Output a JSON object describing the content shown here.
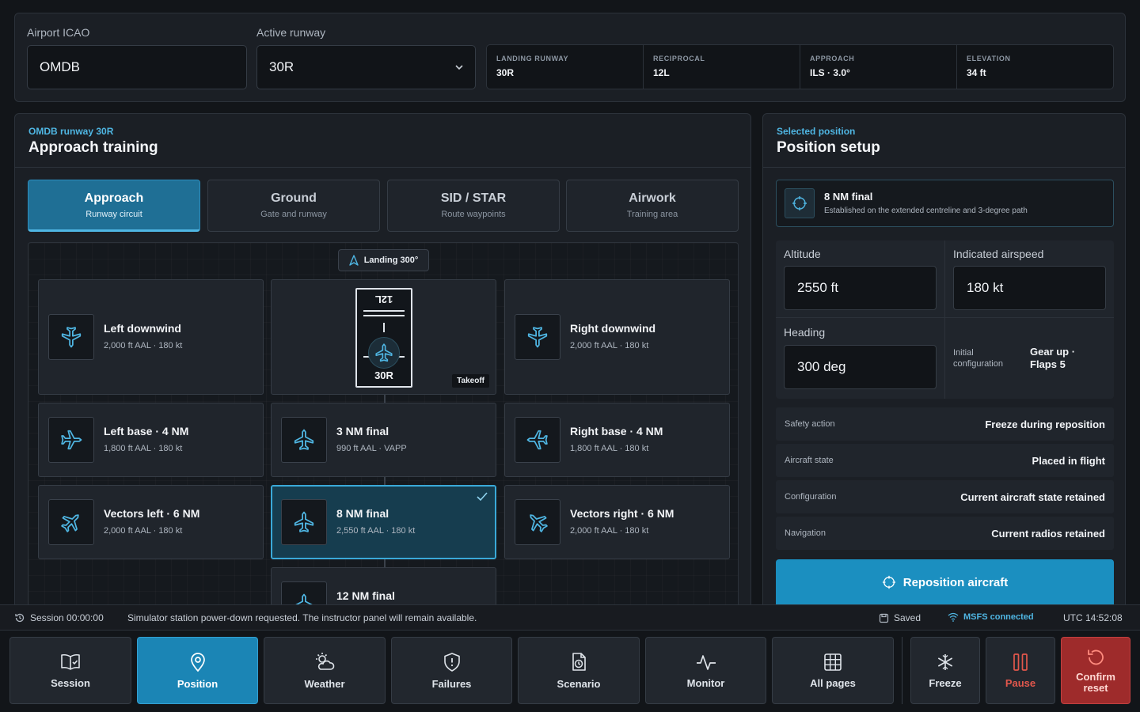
{
  "airport": {
    "icao_label": "Airport ICAO",
    "icao_value": "OMDB",
    "runway_label": "Active runway",
    "runway_value": "30R",
    "info": [
      {
        "key": "LANDING RUNWAY",
        "value": "30R"
      },
      {
        "key": "RECIPROCAL",
        "value": "12L"
      },
      {
        "key": "APPROACH",
        "value": "ILS · 3.0°"
      },
      {
        "key": "ELEVATION",
        "value": "34 ft"
      }
    ]
  },
  "training": {
    "eyebrow": "OMDB runway 30R",
    "title": "Approach training",
    "tabs": [
      {
        "title": "Approach",
        "sub": "Runway circuit"
      },
      {
        "title": "Ground",
        "sub": "Gate and runway"
      },
      {
        "title": "SID / STAR",
        "sub": "Route waypoints"
      },
      {
        "title": "Airwork",
        "sub": "Training area"
      }
    ],
    "landing_pill": "Landing 300°",
    "runway": {
      "top": "12L",
      "bottom": "30R",
      "takeoff_tag": "Takeoff"
    },
    "positions": [
      {
        "title": "Left downwind",
        "sub": "2,000 ft AAL · 180 kt"
      },
      {
        "title": "Right downwind",
        "sub": "2,000 ft AAL · 180 kt"
      },
      {
        "title": "Left base · 4 NM",
        "sub": "1,800 ft AAL · 180 kt"
      },
      {
        "title": "3 NM final",
        "sub": "990 ft AAL · VAPP"
      },
      {
        "title": "Right base · 4 NM",
        "sub": "1,800 ft AAL · 180 kt"
      },
      {
        "title": "Vectors left · 6 NM",
        "sub": "2,000 ft AAL · 180 kt"
      },
      {
        "title": "8 NM final",
        "sub": "2,550 ft AAL · 180 kt"
      },
      {
        "title": "Vectors right · 6 NM",
        "sub": "2,000 ft AAL · 180 kt"
      },
      {
        "title": "12 NM final",
        "sub": ""
      }
    ]
  },
  "setup": {
    "eyebrow": "Selected position",
    "title": "Position setup",
    "selected": {
      "title": "8 NM final",
      "desc": "Established on the extended centreline and 3-degree path"
    },
    "altitude_label": "Altitude",
    "altitude_value": "2550 ft",
    "ias_label": "Indicated airspeed",
    "ias_value": "180 kt",
    "heading_label": "Heading",
    "heading_value": "300 deg",
    "config_label_1": "Initial",
    "config_label_2": "configuration",
    "config_value_1": "Gear up ·",
    "config_value_2": "Flaps 5",
    "rows": [
      {
        "key": "Safety action",
        "value": "Freeze during reposition"
      },
      {
        "key": "Aircraft state",
        "value": "Placed in flight"
      },
      {
        "key": "Configuration",
        "value": "Current aircraft state retained"
      },
      {
        "key": "Navigation",
        "value": "Current radios retained"
      }
    ],
    "cta": "Reposition aircraft"
  },
  "status": {
    "session": "Session 00:00:00",
    "message": "Simulator station power-down requested. The instructor panel will remain available.",
    "saved": "Saved",
    "connection": "MSFS connected",
    "clock": "UTC 14:52:08",
    "accent": "#4fb6e3"
  },
  "nav": {
    "session": "Session",
    "position": "Position",
    "weather": "Weather",
    "failures": "Failures",
    "scenario": "Scenario",
    "monitor": "Monitor",
    "all_pages": "All pages",
    "freeze": "Freeze",
    "pause": "Pause",
    "confirm_1": "Confirm",
    "confirm_2": "reset"
  }
}
